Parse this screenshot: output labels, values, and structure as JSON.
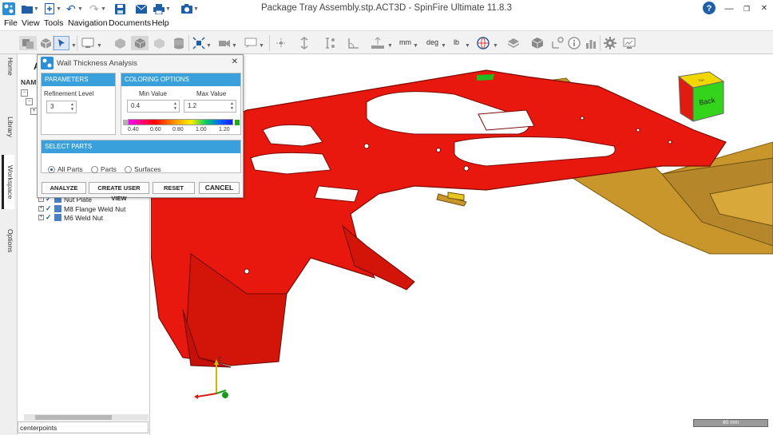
{
  "window": {
    "title": "Package Tray Assembly.stp.ACT3D - SpinFire Ultimate 11.8.3",
    "help": "?",
    "minimize": "—",
    "restore": "❐",
    "close": "✕"
  },
  "menu": [
    "File",
    "View",
    "Tools",
    "Navigation",
    "Documents",
    "Help"
  ],
  "toolbar": {
    "units": {
      "length": "mm",
      "angle": "deg",
      "mass": "lb"
    }
  },
  "left_tabs": [
    "Home",
    "Library",
    "Workspace",
    "Options"
  ],
  "side_panel": {
    "header_partial": "A",
    "name_col": "NAME",
    "tree_items": [
      {
        "label": "Nut Plate"
      },
      {
        "label": "M8 Flange Weld Nut"
      },
      {
        "label": "M6 Weld Nut"
      }
    ],
    "search_value": "centerpoints"
  },
  "dialog": {
    "title": "Wall Thickness Analysis",
    "close": "✕",
    "parameters": {
      "heading": "PARAMETERS",
      "refinement_label": "Refinement Level",
      "refinement_value": "3"
    },
    "coloring": {
      "heading": "COLORING OPTIONS",
      "min_label": "Min Value",
      "max_label": "Max Value",
      "min_value": "0.4",
      "max_value": "1.2",
      "ticks": [
        "0.40",
        "0.60",
        "0.80",
        "1.00",
        "1.20"
      ],
      "below_color": "#b0b0b0",
      "above_color": "#22aa22"
    },
    "select_parts": {
      "heading": "SELECT PARTS",
      "options": [
        "All Parts",
        "Parts",
        "Surfaces"
      ],
      "selected": "All Parts"
    },
    "buttons": {
      "analyze": "ANALYZE",
      "create_view": "CREATE USER VIEW",
      "reset": "RESET",
      "cancel": "CANCEL"
    }
  },
  "viewport": {
    "viewcube_label": "Back",
    "viewcube_top_label": "TOP",
    "axis_z": "Z",
    "scale_label": "80 mm",
    "model_color": "#e8180f",
    "plate_color": "#c8962a"
  }
}
